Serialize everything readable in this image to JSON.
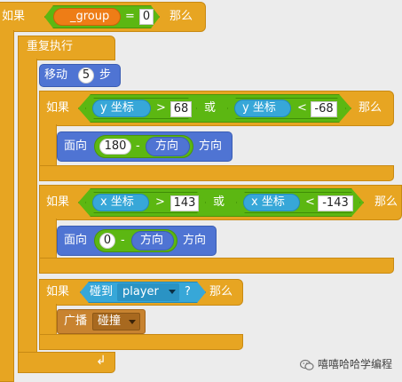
{
  "if_label": "如果",
  "then_label": "那么",
  "top_if": {
    "var": "_group",
    "eq": "=",
    "value": "0"
  },
  "forever_label": "重复执行",
  "move": {
    "label": "移动",
    "steps": "5",
    "unit": "步"
  },
  "if1": {
    "left": {
      "sensor": "y 坐标",
      "op": ">",
      "value": "68"
    },
    "or": "或",
    "right": {
      "sensor": "y 坐标",
      "op": "<",
      "value": "-68"
    }
  },
  "point1": {
    "label": "面向",
    "a": "180",
    "minus": "-",
    "dir": "方向",
    "suffix": "方向"
  },
  "if2": {
    "left": {
      "sensor": "x 坐标",
      "op": ">",
      "value": "143"
    },
    "or": "或",
    "right": {
      "sensor": "x 坐标",
      "op": "<",
      "value": "-143"
    }
  },
  "point2": {
    "label": "面向",
    "a": "0",
    "minus": "-",
    "dir": "方向",
    "suffix": "方向"
  },
  "if3": {
    "touch": "碰到",
    "target": "player",
    "q": "?"
  },
  "broadcast": {
    "label": "广播",
    "message": "碰撞"
  },
  "watermark": "嘻嘻哈哈学编程",
  "colors": {
    "control": "#e7a522",
    "motion": "#4f74d3",
    "operators": "#5cb712",
    "sensing": "#37a7d8",
    "variables": "#ee7d16",
    "events": "#c88330"
  }
}
